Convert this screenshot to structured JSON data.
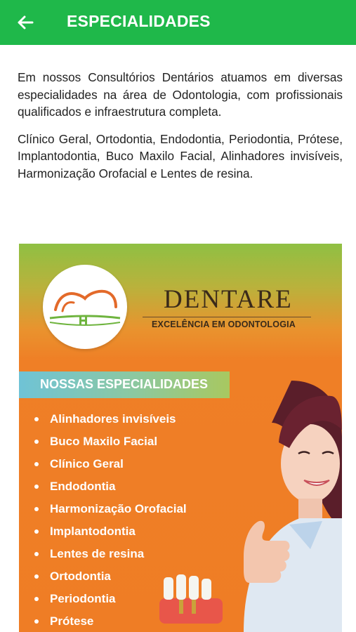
{
  "appbar": {
    "title": "ESPECIALIDADES",
    "back_icon": "arrow-left-icon",
    "color": "#1fb84a"
  },
  "intro": {
    "paragraph1": "Em nossos Consultórios Dentários atuamos em diversas especialidades na área de Odontologia, com profissionais qualificados e infraestrutura completa.",
    "paragraph2": "Clínico Geral, Ortodontia, Endodontia, Periodontia, Prótese, Implantodontia, Buco Maxilo Facial, Alinhadores invisíveis, Harmonização Orofacial e Lentes de resina."
  },
  "banner": {
    "brand": "DENTARE",
    "tagline": "EXCELÊNCIA EM ODONTOLOGIA",
    "section_title": "NOSSAS ESPECIALIDADES",
    "items": [
      "Alinhadores invisíveis",
      "Buco Maxilo Facial",
      "Clínico Geral",
      "Endodontia",
      "Harmonização Orofacial",
      "Implantodontia",
      "Lentes de resina",
      "Ortodontia",
      "Periodontia",
      "Prótese"
    ]
  }
}
